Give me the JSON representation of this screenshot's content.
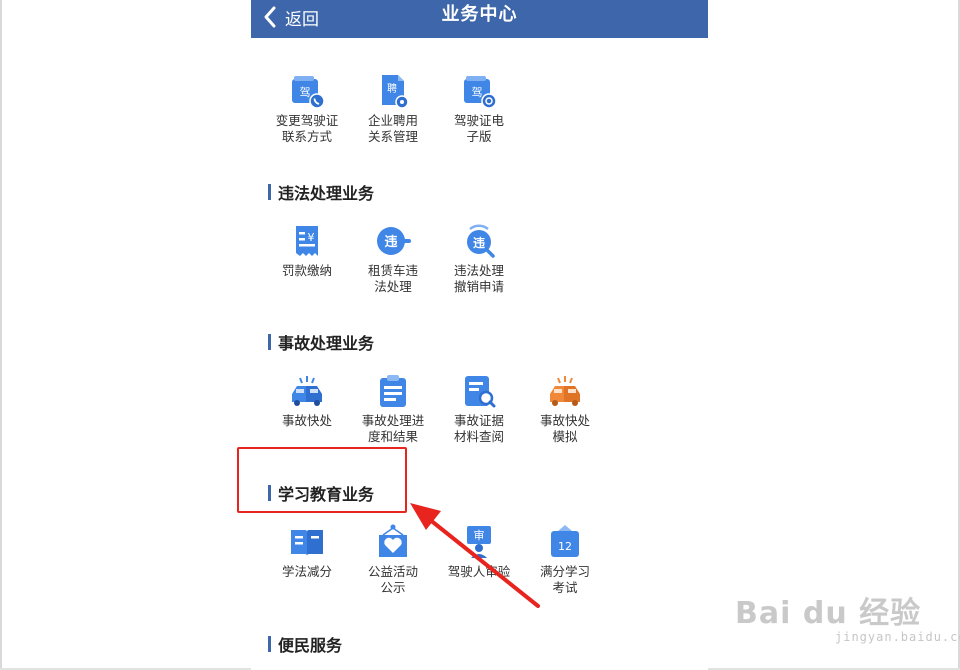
{
  "header": {
    "back_label": "返回",
    "title": "业务中心"
  },
  "sections": {
    "license": {
      "items": [
        {
          "label": "变更驾驶证\n联系方式",
          "icon": "license-phone-icon",
          "badge": "驾"
        },
        {
          "label": "企业聘用\n关系管理",
          "icon": "employment-doc-icon",
          "badge": "聘"
        },
        {
          "label": "驾驶证电\n子版",
          "icon": "e-license-icon",
          "badge": "驾"
        }
      ]
    },
    "violation": {
      "title": "违法处理业务",
      "items": [
        {
          "label": "罚款缴纳",
          "icon": "fine-receipt-icon",
          "badge": "¥"
        },
        {
          "label": "租赁车违\n法处理",
          "icon": "rental-violation-icon",
          "badge": "违"
        },
        {
          "label": "违法处理\n撤销申请",
          "icon": "violation-revoke-icon",
          "badge": "违"
        }
      ]
    },
    "accident": {
      "title": "事故处理业务",
      "items": [
        {
          "label": "事故快处",
          "icon": "accident-cars-icon"
        },
        {
          "label": "事故处理进\n度和结果",
          "icon": "accident-progress-icon"
        },
        {
          "label": "事故证据\n材料查阅",
          "icon": "evidence-search-icon"
        },
        {
          "label": "事故快处\n模拟",
          "icon": "accident-simulation-icon"
        }
      ]
    },
    "study": {
      "title": "学习教育业务",
      "items": [
        {
          "label": "学法减分",
          "icon": "open-book-icon"
        },
        {
          "label": "公益活动\n公示",
          "icon": "charity-heart-icon"
        },
        {
          "label": "驾驶人审验",
          "icon": "driver-review-icon",
          "badge": "审"
        },
        {
          "label": "满分学习\n考试",
          "icon": "calendar-exam-icon",
          "badge": "12"
        }
      ]
    },
    "convenience": {
      "title": "便民服务"
    }
  },
  "watermark": {
    "main": "Bai du 经验",
    "sub": "jingyan.baidu.com"
  },
  "colors": {
    "header": "#3e66aa",
    "icon_blue": "#3f86e6",
    "icon_orange": "#f0883a",
    "annotation_red": "#e8241f"
  }
}
